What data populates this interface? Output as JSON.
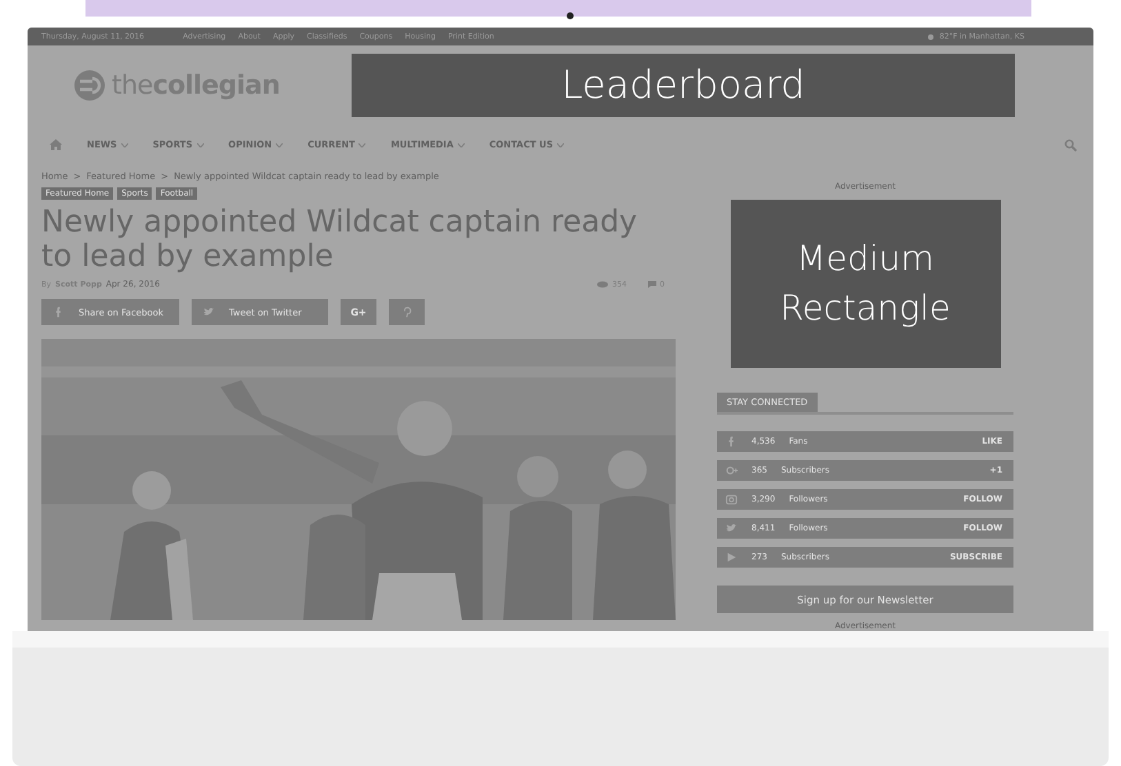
{
  "top_bar": {
    "date": "Thursday, August 11, 2016",
    "links": [
      "Advertising",
      "About",
      "Apply",
      "Classifieds",
      "Coupons",
      "Housing",
      "Print Edition"
    ],
    "weather": "82°F in Manhattan, KS"
  },
  "header": {
    "logo_light": "the",
    "logo_bold": "collegian",
    "leaderboard": "Leaderboard"
  },
  "nav": [
    {
      "label": "NEWS",
      "dropdown": true
    },
    {
      "label": "SPORTS",
      "dropdown": true
    },
    {
      "label": "OPINION",
      "dropdown": true
    },
    {
      "label": "CURRENT",
      "dropdown": true
    },
    {
      "label": "MULTIMEDIA",
      "dropdown": true
    },
    {
      "label": "CONTACT US",
      "dropdown": true
    }
  ],
  "breadcrumb_separator": ">",
  "breadcrumb": [
    "Home",
    "Featured Home",
    "Newly appointed Wildcat captain ready to lead by example"
  ],
  "tags": [
    "Featured Home",
    "Sports",
    "Football"
  ],
  "article": {
    "title": "Newly appointed Wildcat captain ready to lead by example",
    "by": "By",
    "author": "Scott Popp",
    "date": "Apr 26, 2016",
    "views": "354",
    "comments": "0"
  },
  "share": [
    {
      "kind": "facebook",
      "label": "Share on Facebook"
    },
    {
      "kind": "twitter",
      "label": "Tweet on Twitter"
    },
    {
      "kind": "googleplus",
      "label": "G+"
    },
    {
      "kind": "pinterest"
    }
  ],
  "sidebar": {
    "ad_label": "Advertisement",
    "medium_rectangle": "Medium Rectangle",
    "section": "STAY CONNECTED",
    "social": [
      {
        "kind": "facebook",
        "count": "4,536",
        "unit": "Fans",
        "action": "LIKE"
      },
      {
        "kind": "googleplus",
        "count": "365",
        "unit": "Subscribers",
        "action": "+1"
      },
      {
        "kind": "instagram",
        "count": "3,290",
        "unit": "Followers",
        "action": "FOLLOW"
      },
      {
        "kind": "twitter",
        "count": "8,411",
        "unit": "Followers",
        "action": "FOLLOW"
      },
      {
        "kind": "youtube",
        "count": "273",
        "unit": "Subscribers",
        "action": "SUBSCRIBE"
      }
    ],
    "newsletter": "Sign up for our Newsletter",
    "ad_label_bottom": "Advertisement"
  }
}
